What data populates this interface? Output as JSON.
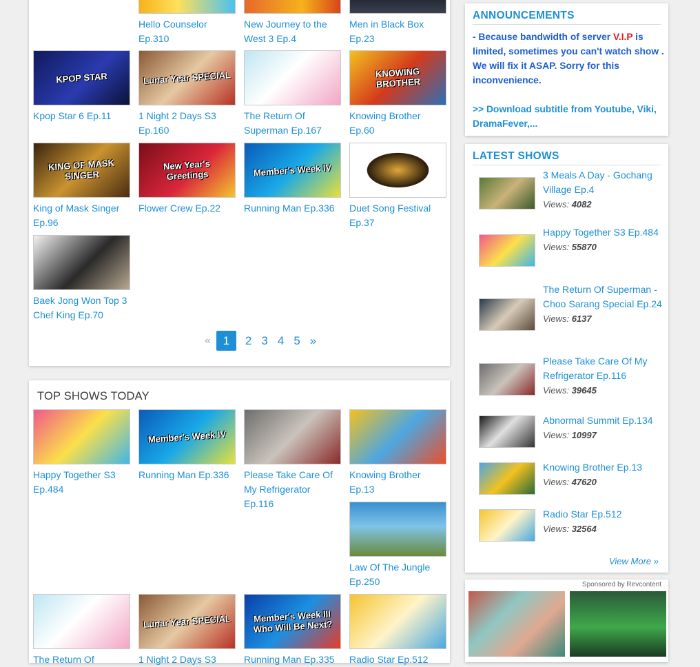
{
  "recent_shows": [
    {
      "title": "Hello Counselor Ep.310",
      "label": ""
    },
    {
      "title": "New Journey to the West 3 Ep.4",
      "label": ""
    },
    {
      "title": "Men in Black Box Ep.23",
      "label": ""
    },
    {
      "title": "Kpop Star 6 Ep.11",
      "label": "KPOP STAR"
    },
    {
      "title": "1 Night 2 Days S3 Ep.160",
      "label": "Lunar Year SPECIAL"
    },
    {
      "title": "The Return Of Superman Ep.167",
      "label": ""
    },
    {
      "title": "Knowing Brother Ep.60",
      "label": "KNOWING BROTHER"
    },
    {
      "title": "King of Mask Singer Ep.96",
      "label": "KING OF MASK SINGER"
    },
    {
      "title": "Flower Crew Ep.22",
      "label": "New Year's Greetings"
    },
    {
      "title": "Running Man Ep.336",
      "label": "Member's Week IV"
    },
    {
      "title": "Duet Song Festival Ep.37",
      "label": ""
    },
    {
      "title": "Baek Jong Won Top 3 Chef King Ep.70",
      "label": ""
    }
  ],
  "pagination": {
    "prev": "«",
    "pages": [
      "1",
      "2",
      "3",
      "4",
      "5"
    ],
    "current": "1",
    "next": "»"
  },
  "top_shows": {
    "title": "TOP SHOWS TODAY",
    "items": [
      {
        "title": "Happy Together S3 Ep.484",
        "label": ""
      },
      {
        "title": "Running Man Ep.336",
        "label": "Member's Week IV"
      },
      {
        "title": "Please Take Care Of My Refrigerator Ep.116",
        "label": ""
      },
      {
        "title": "Knowing Brother Ep.13",
        "label": ""
      },
      {
        "title": "Law Of The Jungle Ep.250",
        "label": ""
      },
      {
        "title": "The Return Of",
        "label": ""
      },
      {
        "title": "1 Night 2 Days S3",
        "label": "Lunar Year SPECIAL"
      },
      {
        "title": "Running Man Ep.335",
        "label": "Member's Week III Who Will Be Next?"
      },
      {
        "title": "Radio Star Ep.512",
        "label": ""
      }
    ]
  },
  "announcements": {
    "title": "ANNOUNCEMENTS",
    "text_before": "- Because bandwidth of server ",
    "vip": "V.I.P",
    "text_after": " is limited, sometimes you can't watch show . We will fix it ASAP. Sorry for this inconvenience.",
    "download": ">> Download subtitle from Youtube, Viki, DramaFever,..."
  },
  "latest_shows": {
    "title": "LATEST SHOWS",
    "views_label": "Views:",
    "items": [
      {
        "title": "3 Meals A Day - Gochang Village Ep.4",
        "views": "4082"
      },
      {
        "title": "Happy Together S3 Ep.484",
        "views": "55870"
      },
      {
        "title": "The Return Of Superman - Choo Sarang Special Ep.24",
        "views": "6137"
      },
      {
        "title": "Please Take Care Of My Refrigerator Ep.116",
        "views": "39645"
      },
      {
        "title": "Abnormal Summit Ep.134",
        "views": "10997"
      },
      {
        "title": "Knowing Brother Ep.13",
        "views": "47620"
      },
      {
        "title": "Radio Star Ep.512",
        "views": "32564"
      }
    ],
    "view_more": "View More »"
  },
  "sponsored": {
    "label": "Sponsored by Revcontent"
  }
}
